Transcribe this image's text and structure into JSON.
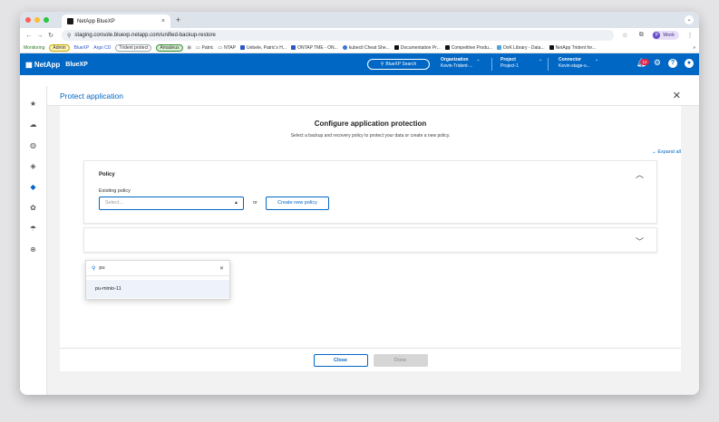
{
  "browser": {
    "tab_title": "NetApp BlueXP",
    "tab_close": "×",
    "new_tab": "+",
    "url": "staging.console.bluexp.netapp.com/unified-backup-restore",
    "profile_label": "Work",
    "profile_initial": "P",
    "bookmarks": [
      {
        "label": "Monitoring",
        "style": "text-green"
      },
      {
        "label": "Admin",
        "style": "pill-yellow"
      },
      {
        "label": "BlueXP",
        "style": "text-blue"
      },
      {
        "label": "Argo CD",
        "style": "text-blue"
      },
      {
        "label": "Trident protect",
        "style": "pill"
      },
      {
        "label": "Amadeus",
        "style": "pill-green"
      },
      {
        "label": "Patric",
        "style": "folder"
      },
      {
        "label": "NTAP",
        "style": "folder"
      },
      {
        "label": "Uebele, Patric's H...",
        "style": "item"
      },
      {
        "label": "ONTAP TME - ON...",
        "style": "item"
      },
      {
        "label": "kubectl Cheat She...",
        "style": "item"
      },
      {
        "label": "Documentation Pr...",
        "style": "item"
      },
      {
        "label": "Competitive Produ...",
        "style": "item"
      },
      {
        "label": "DoK Library - Data...",
        "style": "item"
      },
      {
        "label": "NetApp Trident for...",
        "style": "item"
      }
    ],
    "bookmarks_more": "»"
  },
  "header": {
    "brand": "NetApp",
    "product": "BlueXP",
    "search_label": "BlueXP Search",
    "organization": {
      "title": "Organization",
      "value": "Kevin-Trident-..."
    },
    "project": {
      "title": "Project",
      "value": "Project-1"
    },
    "connector": {
      "title": "Connector",
      "value": "Kevin-stage-s..."
    },
    "notification_count": "12"
  },
  "page": {
    "title": "Protect application",
    "wizard_title": "Configure application protection",
    "wizard_subtitle": "Select a backup and recovery policy to protect your data or create a new policy.",
    "expand_all": "Expand all",
    "policy_card_title": "Policy",
    "existing_policy_label": "Existing policy",
    "select_placeholder": "Select...",
    "or_text": "or",
    "create_policy_label": "Create new policy",
    "dropdown": {
      "search_value": "pu",
      "options": [
        "pu-minio-11"
      ]
    },
    "close_label": "Close",
    "done_label": "Done"
  },
  "colors": {
    "accent": "#0067c5",
    "badge": "#e0284a"
  }
}
